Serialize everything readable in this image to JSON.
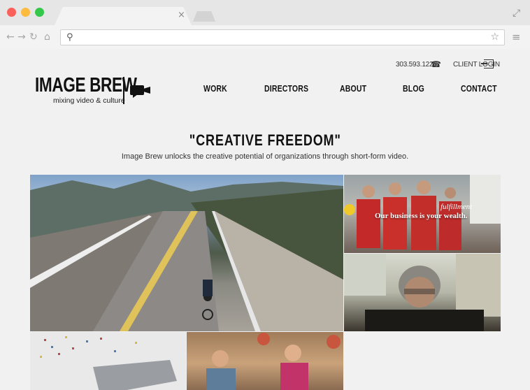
{
  "browser": {
    "address_value": "",
    "address_placeholder": ""
  },
  "utility": {
    "phone": "303.593.1226",
    "client_login": "CLIENT LOGIN"
  },
  "logo": {
    "name": "IMAGE BREW",
    "tagline": "mixing video & culture"
  },
  "nav": {
    "items": [
      "WORK",
      "DIRECTORS",
      "ABOUT",
      "BLOG",
      "CONTACT"
    ]
  },
  "hero": {
    "headline": "\"CREATIVE FREEDOM\"",
    "subheadline": "Image Brew unlocks the creative potential of organizations through short-form video."
  },
  "tiles": {
    "team_overlay": "Our business is your wealth.",
    "team_script": "fulfillment"
  }
}
